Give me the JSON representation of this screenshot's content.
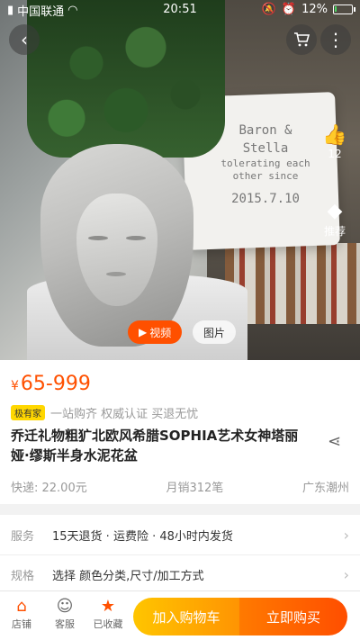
{
  "status_bar": {
    "carrier": "中国联通",
    "time": "20:51",
    "battery": "12%",
    "battery_level": 0.12
  },
  "hero": {
    "pillow_text_line1": "Baron &",
    "pillow_text_line2": "Stella",
    "pillow_text_line3": "tolerating each",
    "pillow_text_line4": "other since",
    "pillow_text_line5": "2015.7.10",
    "video_label": "视频",
    "photo_label": "图片",
    "like_count": "12",
    "recommend_label": "推荐"
  },
  "product": {
    "currency": "¥",
    "price": "65-999",
    "badge": "极有家",
    "tagline": "一站购齐 权威认证 买退无忧",
    "title": "乔迁礼物粗犷北欧风希腊SOPHIA艺术女神塔丽娅·缪斯半身水泥花盆",
    "shipping": "快递: 22.00元",
    "monthly_sales": "月销312笔",
    "location": "广东潮州"
  },
  "service": {
    "label": "服务",
    "value": "15天退货 · 运费险 · 48小时内发货"
  },
  "spec": {
    "label": "规格",
    "value": "选择 颜色分类,尺寸/加工方式"
  },
  "bottom_bar": {
    "shop": "店铺",
    "customer_service": "客服",
    "favorited": "已收藏",
    "add_to_cart": "加入购物车",
    "buy_now": "立即购买"
  },
  "colors": {
    "accent": "#ff5000",
    "cart_button": "#ffa200",
    "buy_button": "#ff5000"
  }
}
